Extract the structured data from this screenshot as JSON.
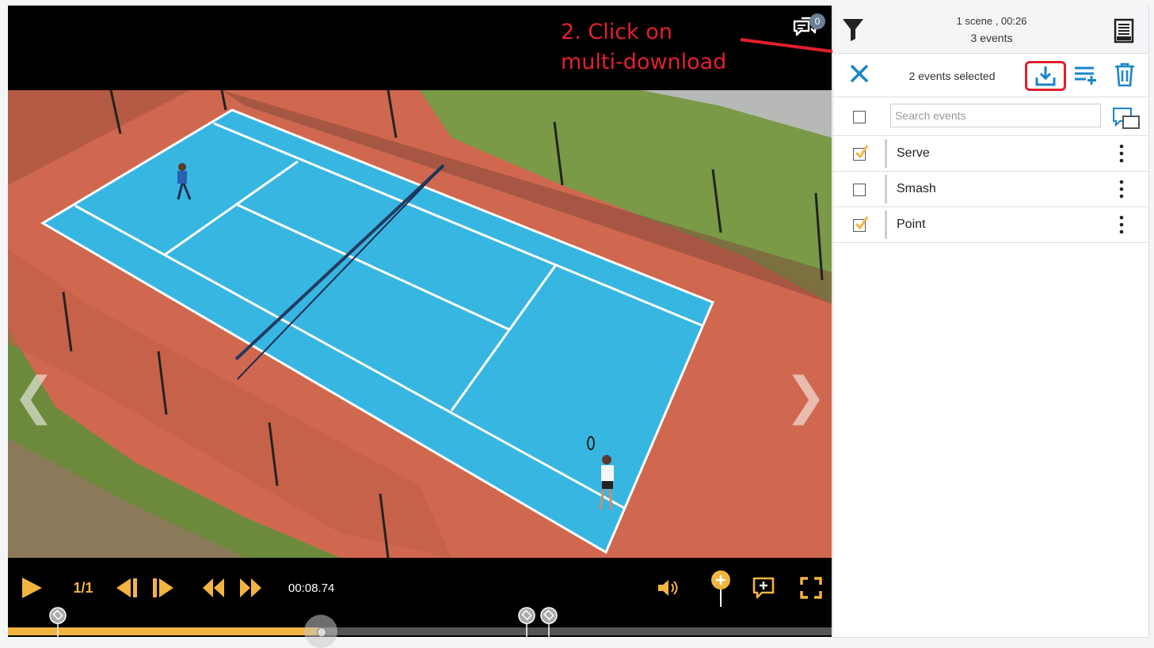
{
  "player": {
    "comments_count": "0",
    "speed": "1/1",
    "timecode": "00:08.74",
    "progress_fraction": 0.38,
    "markers": [
      0.061,
      0.63,
      0.657
    ]
  },
  "annotation": {
    "text": "2. Click on\nmulti-download",
    "color": "#e3202d"
  },
  "panel": {
    "scene_info": "1 scene , 00:26",
    "events_count": "3 events",
    "selected_label": "2 events selected",
    "search_placeholder": "Search events",
    "events": [
      {
        "name": "Serve",
        "checked": true
      },
      {
        "name": "Smash",
        "checked": false
      },
      {
        "name": "Point",
        "checked": true
      }
    ]
  },
  "colors": {
    "accent_blue": "#1a86c8",
    "accent_yellow": "#f2b441",
    "highlight_red": "#e3202d"
  }
}
